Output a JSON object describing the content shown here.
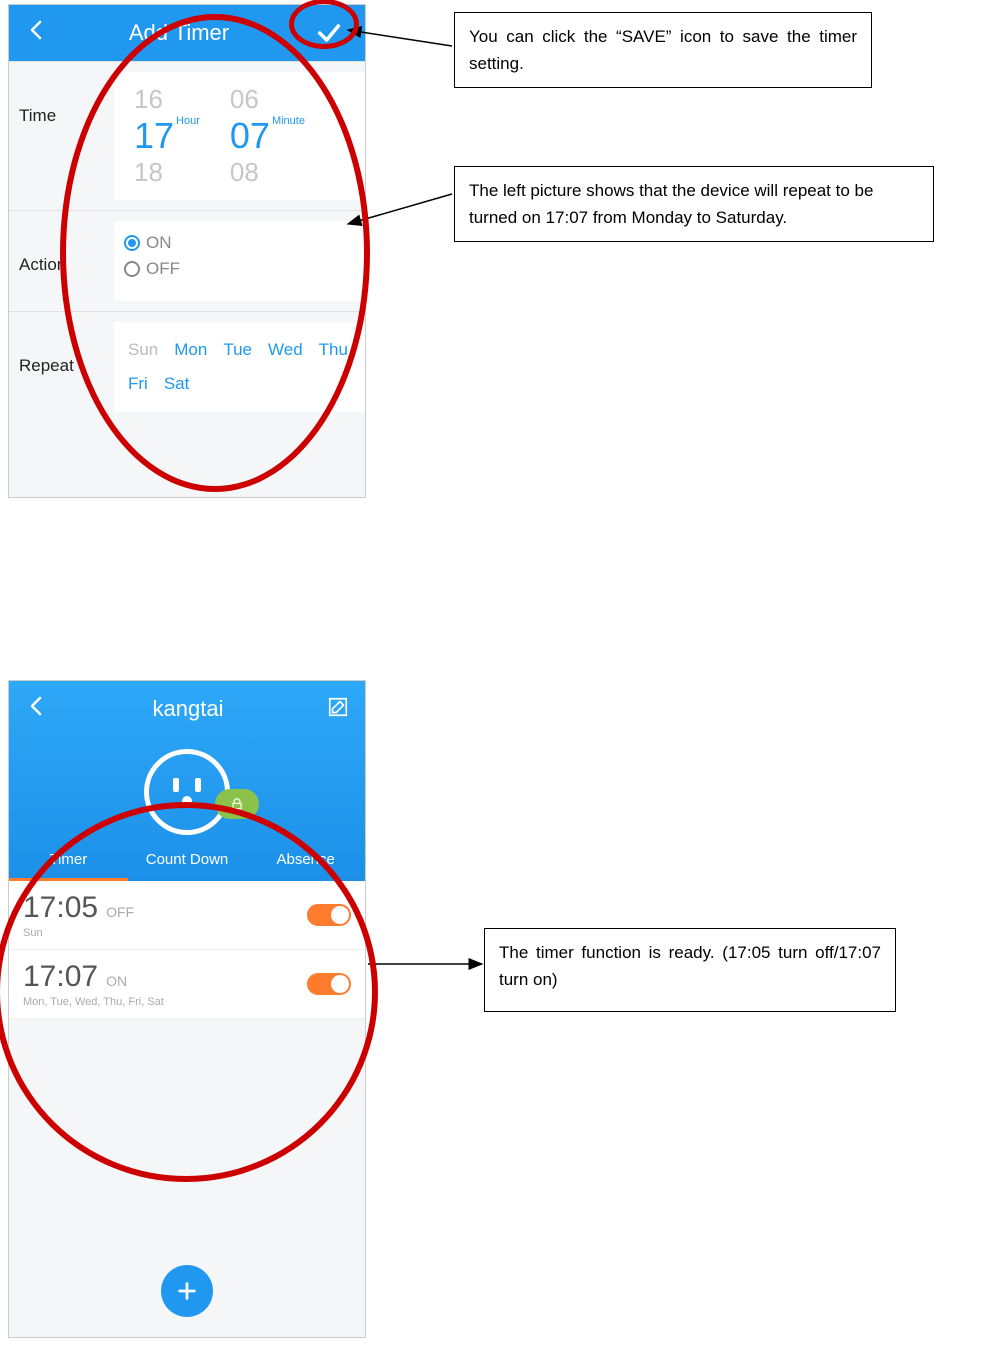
{
  "phone1": {
    "header_title": "Add Timer",
    "time_label": "Time",
    "hour_prev": "16",
    "hour_sel": "17",
    "hour_next": "18",
    "hour_unit": "Hour",
    "minute_prev": "06",
    "minute_sel": "07",
    "minute_next": "08",
    "minute_unit": "Minute",
    "action_label": "Action",
    "on_label": "ON",
    "off_label": "OFF",
    "repeat_label": "Repeat",
    "days": [
      {
        "label": "Sun",
        "on": false
      },
      {
        "label": "Mon",
        "on": true
      },
      {
        "label": "Tue",
        "on": true
      },
      {
        "label": "Wed",
        "on": true
      },
      {
        "label": "Thu",
        "on": true
      },
      {
        "label": "Fri",
        "on": true
      },
      {
        "label": "Sat",
        "on": true
      }
    ]
  },
  "phone2": {
    "header_title": "kangtai",
    "tabs": [
      "Timer",
      "Count Down",
      "Absence"
    ],
    "timers": [
      {
        "time": "17:05",
        "state": "OFF",
        "days": "Sun"
      },
      {
        "time": "17:07",
        "state": "ON",
        "days": "Mon, Tue, Wed, Thu, Fri, Sat"
      }
    ]
  },
  "callouts": {
    "c1": "You can click the “SAVE” icon to save the timer setting.",
    "c2": "The left picture shows that the device will repeat to be turned on 17:07 from Monday to Saturday.",
    "c3": "The timer function is ready. (17:05 turn off/17:07 turn on)"
  }
}
